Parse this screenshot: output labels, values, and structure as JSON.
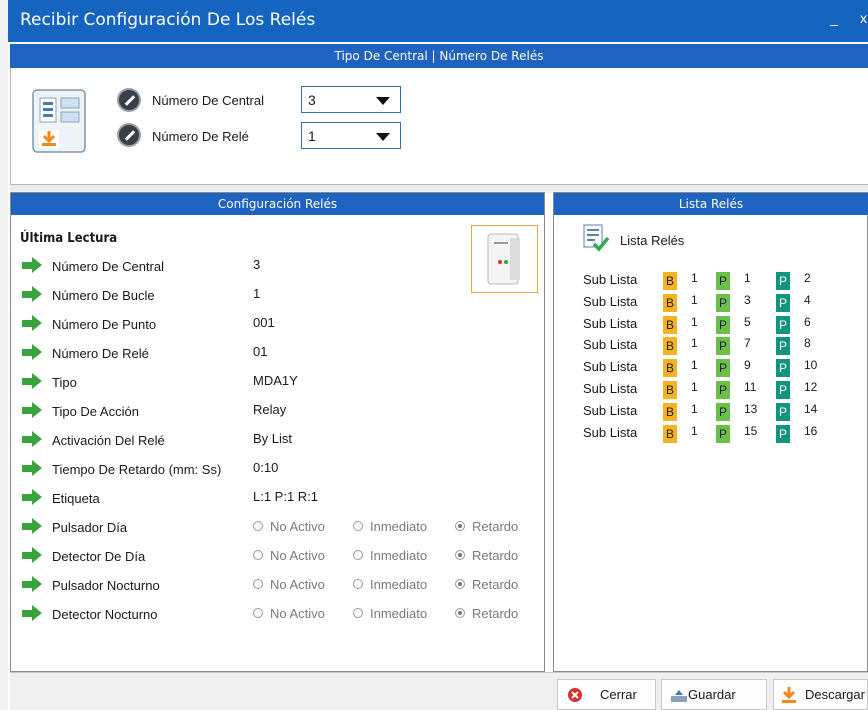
{
  "window": {
    "title": "Recibir Configuración De Los Relés",
    "minimize": "_",
    "close": "x"
  },
  "top_section": {
    "header": "Tipo De Central | Número De Relés",
    "central_label": "Número De Central",
    "central_value": "3",
    "rele_label": "Número De Relé",
    "rele_value": "1"
  },
  "config_panel": {
    "header": "Configuración Relés",
    "heading": "Última Lectura",
    "rows": [
      {
        "label": "Número De Central",
        "value": "3"
      },
      {
        "label": "Número De Bucle",
        "value": "1"
      },
      {
        "label": "Número De Punto",
        "value": "001"
      },
      {
        "label": "Número De Relé",
        "value": "01"
      },
      {
        "label": "Tipo",
        "value": "MDA1Y"
      },
      {
        "label": "Tipo De Acción",
        "value": "Relay"
      },
      {
        "label": "Activación Del Relé",
        "value": "By List"
      },
      {
        "label": "Tiempo De Retardo (mm: Ss)",
        "value": "0:10"
      },
      {
        "label": "Etiqueta",
        "value": "L:1 P:1 R:1"
      }
    ],
    "radio_rows": [
      {
        "label": "Pulsador Día",
        "selected": "Retardo"
      },
      {
        "label": "Detector De Día",
        "selected": "Retardo"
      },
      {
        "label": "Pulsador Nocturno",
        "selected": "Retardo"
      },
      {
        "label": "Detector Nocturno",
        "selected": "Retardo"
      }
    ],
    "radio_options": [
      "No Activo",
      "Inmediato",
      "Retardo"
    ]
  },
  "list_panel": {
    "header": "Lista Relés",
    "title": "Lista Relés",
    "entries": [
      {
        "label": "Sub Lista",
        "b_badge": "B",
        "b_val": "1",
        "p1_badge": "P",
        "p1_val": "1",
        "p2_badge": "P",
        "p2_val": "2"
      },
      {
        "label": "Sub Lista",
        "b_badge": "B",
        "b_val": "1",
        "p1_badge": "P",
        "p1_val": "3",
        "p2_badge": "P",
        "p2_val": "4"
      },
      {
        "label": "Sub Lista",
        "b_badge": "B",
        "b_val": "1",
        "p1_badge": "P",
        "p1_val": "5",
        "p2_badge": "P",
        "p2_val": "6"
      },
      {
        "label": "Sub Lista",
        "b_badge": "B",
        "b_val": "1",
        "p1_badge": "P",
        "p1_val": "7",
        "p2_badge": "P",
        "p2_val": "8"
      },
      {
        "label": "Sub Lista",
        "b_badge": "B",
        "b_val": "1",
        "p1_badge": "P",
        "p1_val": "9",
        "p2_badge": "P",
        "p2_val": "10"
      },
      {
        "label": "Sub Lista",
        "b_badge": "B",
        "b_val": "1",
        "p1_badge": "P",
        "p1_val": "11",
        "p2_badge": "P",
        "p2_val": "12"
      },
      {
        "label": "Sub Lista",
        "b_badge": "B",
        "b_val": "1",
        "p1_badge": "P",
        "p1_val": "13",
        "p2_badge": "P",
        "p2_val": "14"
      },
      {
        "label": "Sub Lista",
        "b_badge": "B",
        "b_val": "1",
        "p1_badge": "P",
        "p1_val": "15",
        "p2_badge": "P",
        "p2_val": "16"
      }
    ]
  },
  "buttons": {
    "close": "Cerrar",
    "save": "Guardar",
    "download": "Descargar"
  },
  "colors": {
    "titlebar": "#1565c0",
    "section_header": "#1e63c0",
    "arrow": "#3aa33f",
    "badge_b": "#f5b324",
    "badge_p1": "#6cc04a",
    "badge_p2": "#13947e",
    "close_icon": "#d93030",
    "download_icon": "#f08a1c"
  }
}
